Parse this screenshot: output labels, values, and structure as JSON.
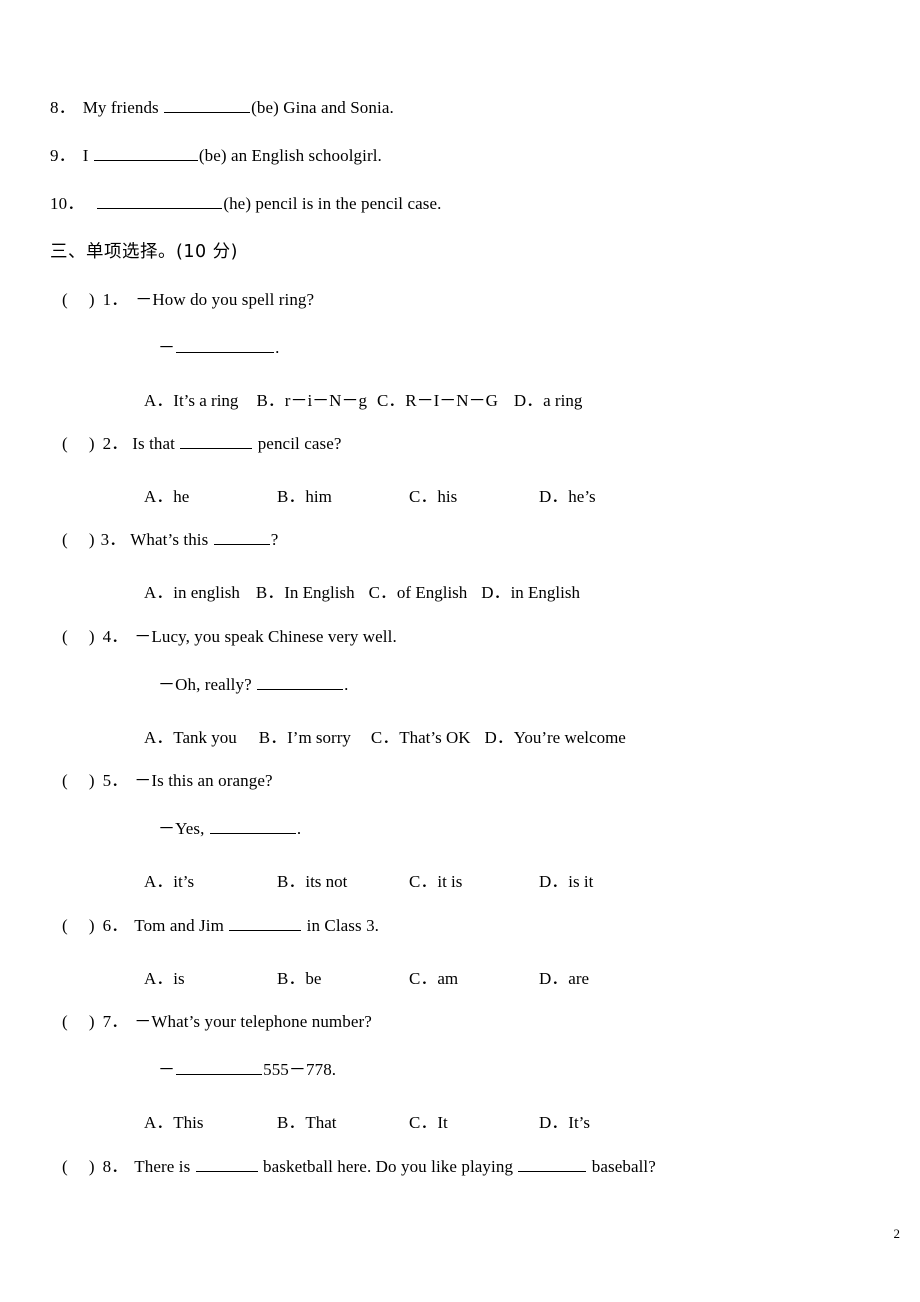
{
  "document": {
    "page_number": "2",
    "fill_in_items": [
      {
        "number": "8．",
        "text_before": "My friends ",
        "blank": "__________",
        "text_after": "(be) Gina and Sonia."
      },
      {
        "number": "9．",
        "text_before": "I ",
        "blank": "___________",
        "text_after": "(be) an English schoolgirl."
      },
      {
        "number": "10．",
        "text_before": "",
        "blank": "______________",
        "text_after": "(he) pencil is in the pencil case."
      }
    ],
    "section": {
      "heading": "三、单项选择。(10 分)"
    },
    "questions": [
      {
        "marker": "(",
        "marker_close": ")",
        "number": "1．",
        "stem": "－How do you spell ring?",
        "stem2_prefix": "－",
        "stem2_blank": "___________",
        "stem2_suffix": ".",
        "layout": "flow",
        "options": [
          {
            "label": "A．",
            "text": "It’s a ring"
          },
          {
            "label": "B．",
            "text": "r－i－N－g"
          },
          {
            "label": "C．",
            "text": "R－I－N－G"
          },
          {
            "label": "D．",
            "text": "a ring"
          }
        ]
      },
      {
        "marker": "(",
        "marker_close": ")",
        "number": "2．",
        "stem_before": "Is that ",
        "stem_blank": "_________",
        "stem_after": " pencil case?",
        "layout": "columns",
        "options": [
          {
            "label": "A．",
            "text": "he"
          },
          {
            "label": "B．",
            "text": "him"
          },
          {
            "label": "C．",
            "text": "his"
          },
          {
            "label": "D．",
            "text": "he’s"
          }
        ]
      },
      {
        "marker": "(",
        "marker_close": ")",
        "number": "3．",
        "stem_before": "What’s this ",
        "stem_blank": "________",
        "stem_after": "?",
        "layout": "flow",
        "options": [
          {
            "label": "A．",
            "text": "in english"
          },
          {
            "label": "B．",
            "text": "In English"
          },
          {
            "label": "C．",
            "text": "of English"
          },
          {
            "label": "D．",
            "text": "in English"
          }
        ]
      },
      {
        "marker": "(",
        "marker_close": ")",
        "number": "4．",
        "stem": "－Lucy, you speak Chinese very well.",
        "stem2_prefix": "－Oh, really? ",
        "stem2_blank": "__________",
        "stem2_suffix": ".",
        "layout": "flow",
        "options": [
          {
            "label": "A．",
            "text": "Tank you"
          },
          {
            "label": "B．",
            "text": "I’m sorry"
          },
          {
            "label": "C．",
            "text": "That’s OK"
          },
          {
            "label": "D．",
            "text": "You’re welcome"
          }
        ]
      },
      {
        "marker": "(",
        "marker_close": ")",
        "number": "5．",
        "stem": "－Is this an orange?",
        "stem2_prefix": "－Yes, ",
        "stem2_blank": "___________",
        "stem2_suffix": ".",
        "layout": "columns",
        "options": [
          {
            "label": "A．",
            "text": "it’s"
          },
          {
            "label": "B．",
            "text": "its not"
          },
          {
            "label": "C．",
            "text": "it is"
          },
          {
            "label": "D．",
            "text": "is it"
          }
        ]
      },
      {
        "marker": "(",
        "marker_close": ")",
        "number": "6．",
        "stem_before": "Tom and Jim ",
        "stem_blank": "_________",
        "stem_after": " in Class 3.",
        "layout": "columns",
        "options": [
          {
            "label": "A．",
            "text": "is"
          },
          {
            "label": "B．",
            "text": "be"
          },
          {
            "label": "C．",
            "text": "am"
          },
          {
            "label": "D．",
            "text": "are"
          }
        ]
      },
      {
        "marker": "(",
        "marker_close": ")",
        "number": "7．",
        "stem": "－What’s your telephone number?",
        "stem2_prefix": "－",
        "stem2_blank": "___________",
        "stem2_suffix": "555－778.",
        "layout": "columns",
        "options": [
          {
            "label": "A．",
            "text": "This"
          },
          {
            "label": "B．",
            "text": "That"
          },
          {
            "label": "C．",
            "text": "It"
          },
          {
            "label": "D．",
            "text": "It’s"
          }
        ]
      },
      {
        "marker": "(",
        "marker_close": ")",
        "number": "8．",
        "stem_before": "There is ",
        "stem_blank": "________",
        "stem_mid": " basketball here. Do you like playing ",
        "stem_blank2": "_________",
        "stem_after": " baseball?",
        "layout": "none",
        "options": []
      }
    ]
  }
}
